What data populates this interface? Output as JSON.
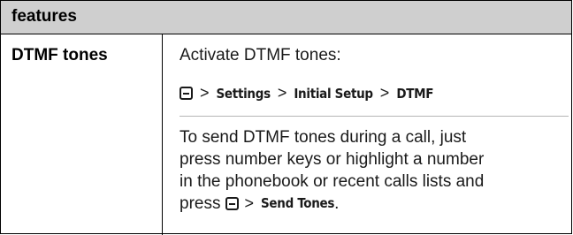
{
  "header": {
    "title": "features"
  },
  "feature": {
    "name": "DTMF tones",
    "intro": "Activate DTMF tones:",
    "path": {
      "key_icon": "menu-key-icon",
      "separator": ">",
      "items": [
        "Settings",
        "Initial Setup",
        "DTMF"
      ]
    },
    "description": {
      "line1": "To send DTMF tones during a call, just",
      "line2": "press number keys or highlight a number",
      "line3": "in the phonebook or recent calls lists and",
      "line4_prefix": "press",
      "line4_separator": ">",
      "line4_action": "Send Tones",
      "line4_suffix": "."
    }
  }
}
